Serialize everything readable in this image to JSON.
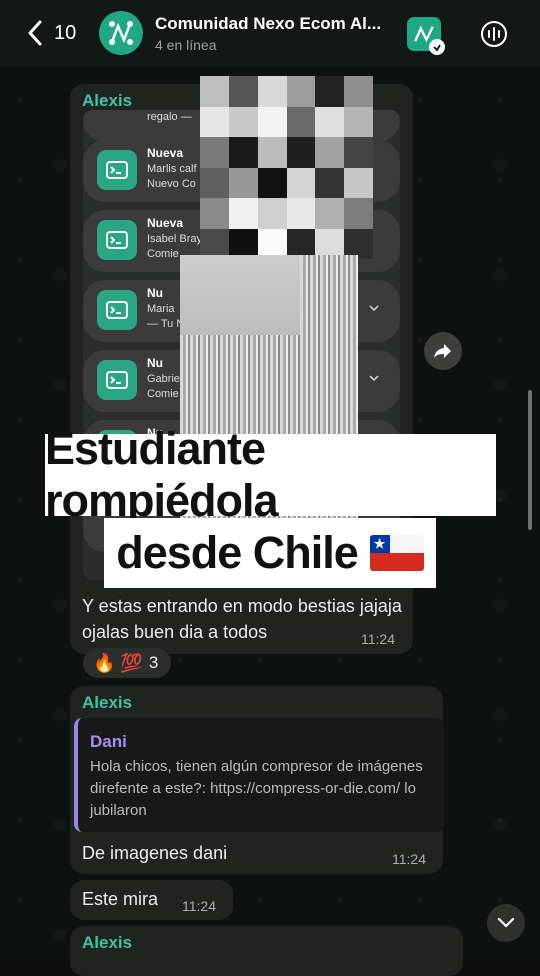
{
  "header": {
    "back_count": "10",
    "title": "Comunidad Nexo Ecom Al...",
    "subtitle": "4 en línea"
  },
  "messages": [
    {
      "sender": "Alexis",
      "notifications": [
        {
          "head": "",
          "body": "regalo —"
        },
        {
          "head": "Nueva",
          "body1": "Marlis calf",
          "body2": "Nuevo Co"
        },
        {
          "head": "Nueva",
          "body1": "Isabel Bray",
          "body2": "Comie"
        },
        {
          "head": "Nu",
          "body1": "Maria",
          "body2": "— Tu N"
        },
        {
          "head": "Nu",
          "body1": "Gabrie",
          "body2": "Comie"
        },
        {
          "head": "Nu",
          "body1": "",
          "body2": ""
        }
      ],
      "text": "Y estas entrando en modo bestias jajaja ojalas buen dia a todos",
      "time": "11:24",
      "reactions": {
        "emojis": "🔥 💯",
        "count": "3"
      }
    },
    {
      "sender": "Alexis",
      "quote": {
        "name": "Dani",
        "text": "Hola chicos, tienen algún compresor de imágenes direfente a este?: https://compress-or-die.com/ lo jubilaron"
      },
      "text": "De imagenes dani",
      "time": "11:24"
    },
    {
      "text": "Este mira",
      "time": "11:24"
    },
    {
      "sender": "Alexis"
    }
  ],
  "overlay": {
    "line1": "Estudiante rompiédola",
    "line2": "desde Chile"
  },
  "colors": {
    "accent": "#3dc4a4",
    "bubble": "#1f2421",
    "quote_accent": "#9b84e6"
  }
}
